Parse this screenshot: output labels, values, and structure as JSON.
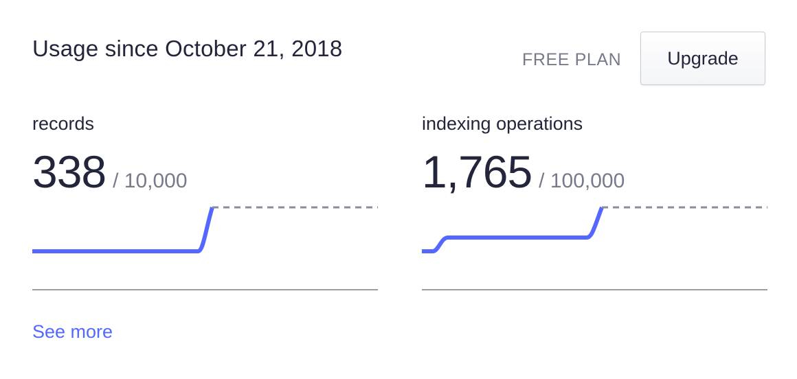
{
  "header": {
    "title": "Usage since October 21, 2018",
    "plan_label": "FREE PLAN",
    "upgrade_label": "Upgrade"
  },
  "metrics": [
    {
      "label": "records",
      "value": "338",
      "limit": "/ 10,000",
      "trend_shape": "flat then sharp rise near end"
    },
    {
      "label": "indexing operations",
      "value": "1,765",
      "limit": "/ 100,000",
      "trend_shape": "small step early, flat, then sharp rise near end"
    }
  ],
  "footer": {
    "see_more_label": "See more"
  },
  "colors": {
    "accent": "#5468ff",
    "text": "#23263b",
    "muted": "#777a8a",
    "dashed_projection": "#8a8c99",
    "baseline": "#9a9ca6"
  }
}
